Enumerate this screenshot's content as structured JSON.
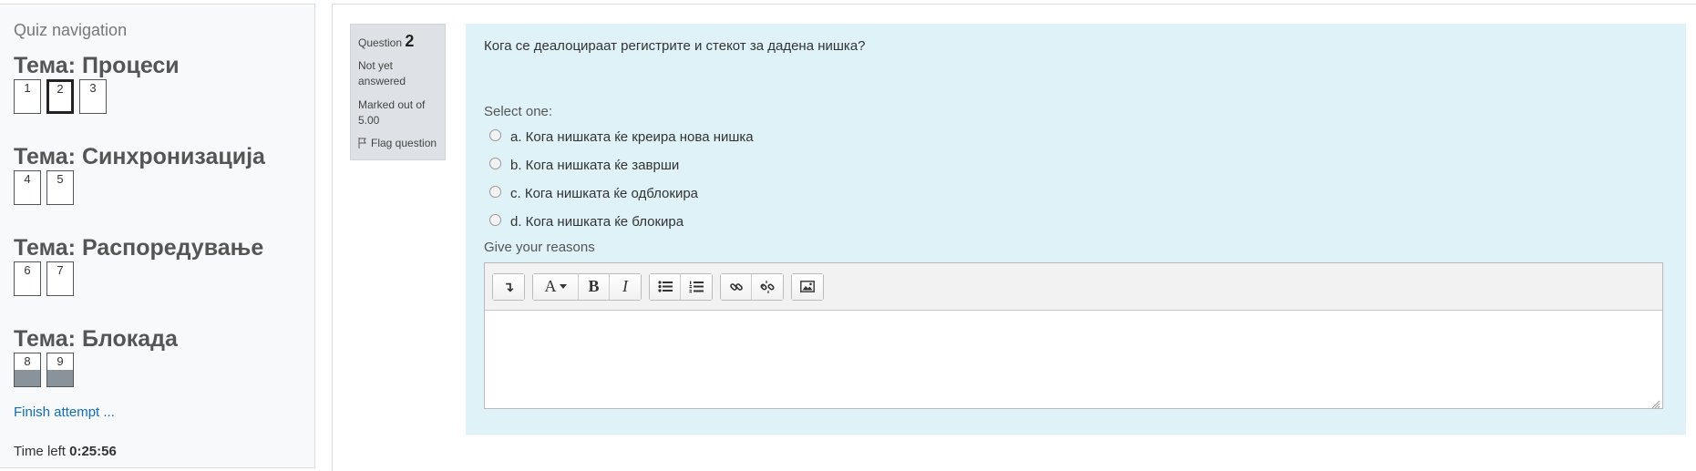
{
  "nav": {
    "title": "Quiz navigation",
    "sections": [
      {
        "title": "Тема: Процеси",
        "buttons": [
          {
            "label": "1",
            "state": "normal"
          },
          {
            "label": "2",
            "state": "current"
          },
          {
            "label": "3",
            "state": "normal"
          }
        ]
      },
      {
        "title": "Тема: Синхронизација",
        "buttons": [
          {
            "label": "4",
            "state": "normal"
          },
          {
            "label": "5",
            "state": "normal"
          }
        ]
      },
      {
        "title": "Тема: Распоредување",
        "buttons": [
          {
            "label": "6",
            "state": "normal"
          },
          {
            "label": "7",
            "state": "normal"
          }
        ]
      },
      {
        "title": "Тема: Блокада",
        "buttons": [
          {
            "label": "8",
            "state": "flagged"
          },
          {
            "label": "9",
            "state": "flagged"
          }
        ]
      }
    ],
    "finish_link": "Finish attempt ...",
    "time_left_label": "Time left",
    "time_left_value": "0:25:56"
  },
  "question": {
    "label": "Question",
    "number": "2",
    "state": "Not yet answered",
    "grade": "Marked out of 5.00",
    "flag_label": "Flag question",
    "text": "Кога се деалоцираат регистрите и стекот за дадена нишка?",
    "prompt": "Select one:",
    "answers": [
      "a. Кога нишката ќе креира нова нишка",
      "b. Кога нишката ќе заврши",
      "c. Кога нишката ќе одблокира",
      "d. Кога нишката ќе блокира"
    ],
    "reasons_label": "Give your reasons"
  },
  "editor": {
    "toolbar": [
      {
        "group": "toggle",
        "icons": [
          "toolbar-toggle-icon"
        ]
      },
      {
        "group": "style",
        "icons": [
          "font-style-icon",
          "bold-icon",
          "italic-icon"
        ]
      },
      {
        "group": "lists",
        "icons": [
          "unordered-list-icon",
          "ordered-list-icon"
        ]
      },
      {
        "group": "links",
        "icons": [
          "link-icon",
          "unlink-icon"
        ]
      },
      {
        "group": "media",
        "icons": [
          "image-icon"
        ]
      }
    ],
    "font_style_glyph": "A",
    "bold_glyph": "B",
    "italic_glyph": "I",
    "toggle_glyph": "↴",
    "content": ""
  }
}
